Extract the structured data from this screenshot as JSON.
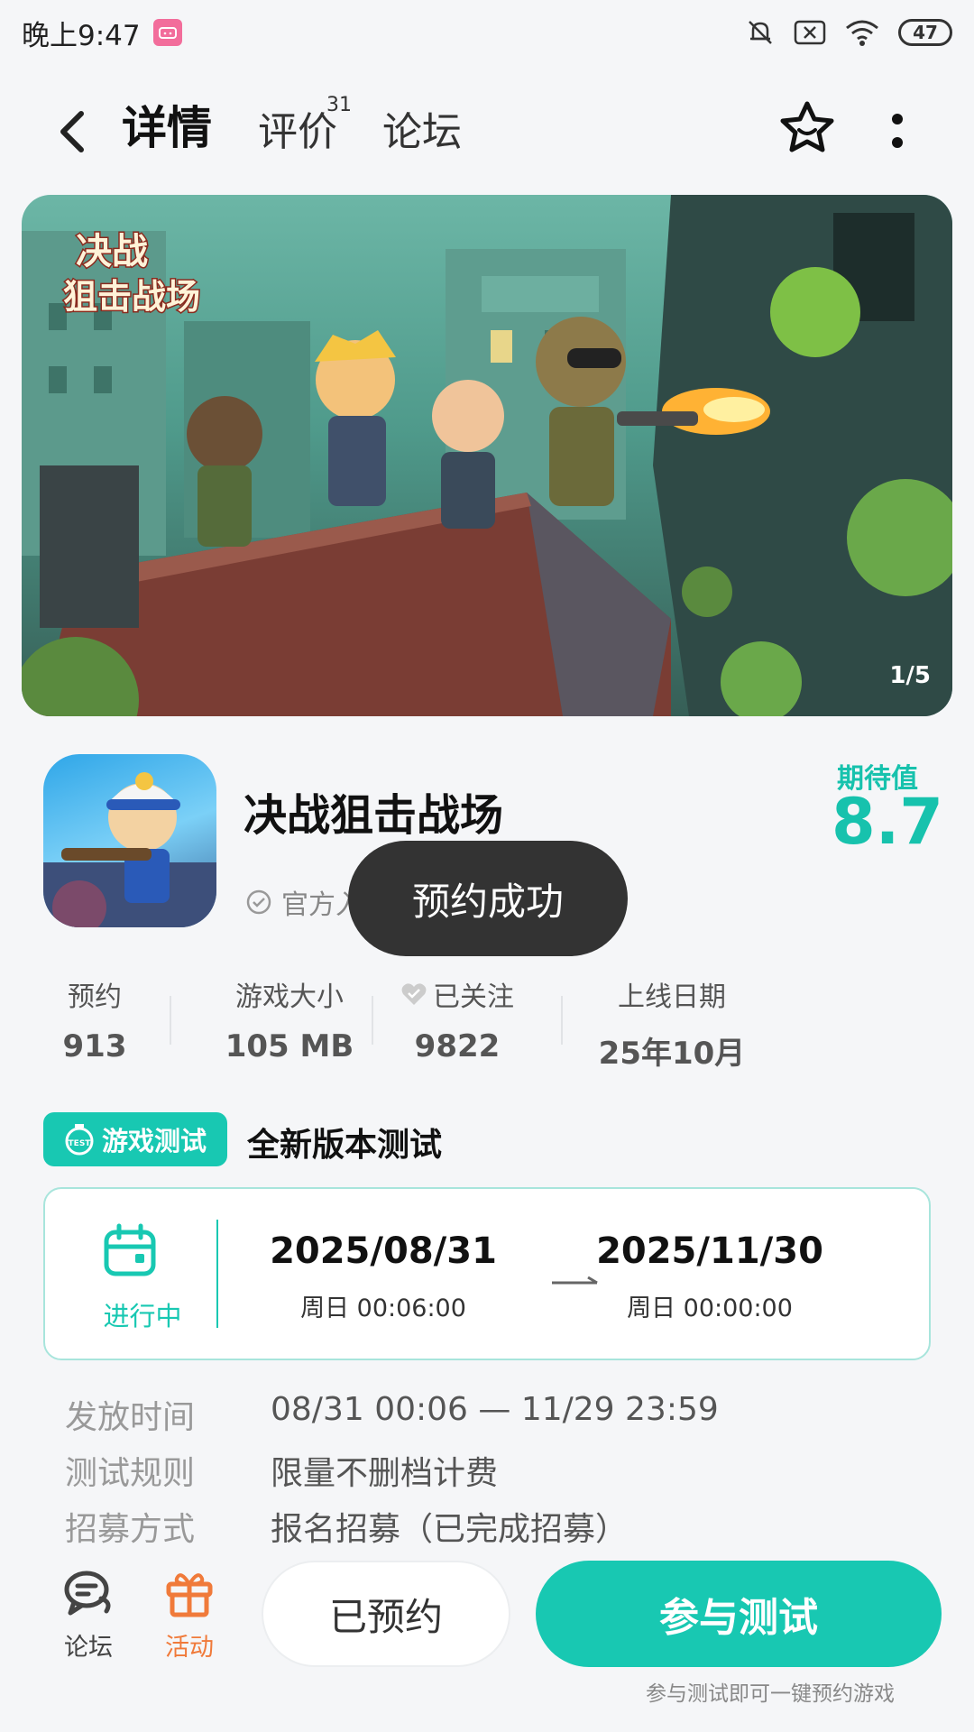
{
  "status_bar": {
    "time": "晚上9:47",
    "app_badge": "bilibili",
    "battery": "47"
  },
  "nav": {
    "tabs": [
      {
        "label": "详情",
        "active": true
      },
      {
        "label": "评价",
        "count": "31"
      },
      {
        "label": "论坛"
      }
    ]
  },
  "banner": {
    "logo_text": "决战狙击战场",
    "counter": "1/5"
  },
  "app": {
    "name": "决战狙击战场",
    "official_label": "官方入驻",
    "expect_label": "期待值",
    "expect_value": "8.7"
  },
  "toast": {
    "text": "预约成功"
  },
  "stats": [
    {
      "label": "预约",
      "value": "913"
    },
    {
      "label": "游戏大小",
      "value": "105 MB"
    },
    {
      "label": "已关注",
      "value": "9822"
    },
    {
      "label": "上线日期",
      "value": "25年10月"
    }
  ],
  "test": {
    "tag": "游戏测试",
    "title": "全新版本测试",
    "status": "进行中",
    "start_date": "2025/08/31",
    "start_time": "周日  00:06:00",
    "end_date": "2025/11/30",
    "end_time": "周日  00:00:00"
  },
  "details": [
    {
      "key": "发放时间",
      "value": "08/31 00:06 — 11/29 23:59"
    },
    {
      "key": "测试规则",
      "value": "限量不删档计费"
    },
    {
      "key": "招募方式",
      "value": "报名招募（已完成招募）"
    }
  ],
  "bottom": {
    "forum_label": "论坛",
    "activity_label": "活动",
    "reserved_label": "已预约",
    "join_label": "参与测试",
    "join_hint": "参与测试即可一键预约游戏"
  },
  "colors": {
    "accent": "#18c8b2",
    "activity": "#f07a3a",
    "toast_bg": "#333333"
  }
}
